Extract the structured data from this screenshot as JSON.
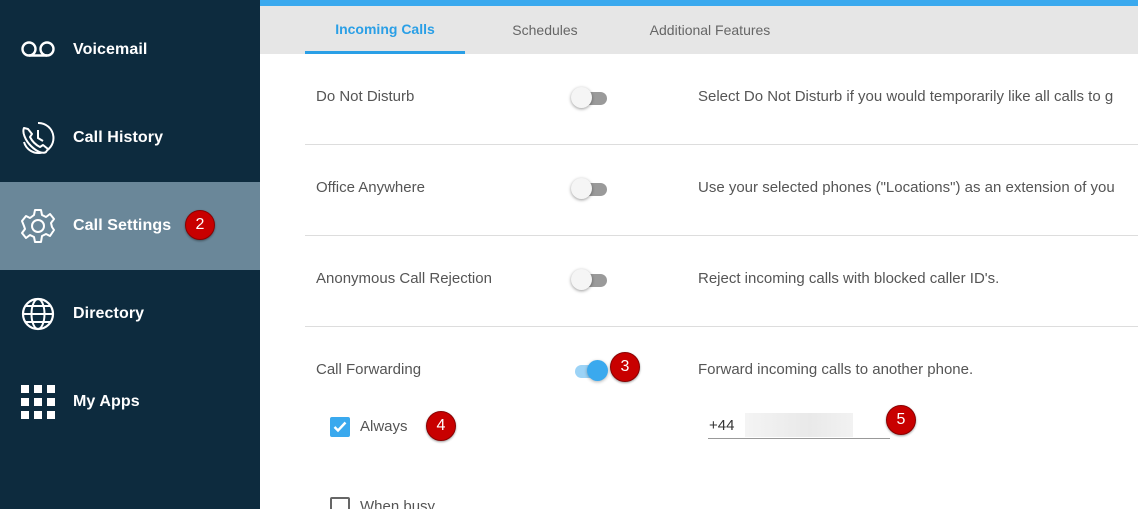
{
  "sidebar": {
    "items": [
      {
        "label": "Voicemail",
        "icon": "voicemail-icon"
      },
      {
        "label": "Call History",
        "icon": "call-history-icon"
      },
      {
        "label": "Call Settings",
        "icon": "gear-icon",
        "active": true,
        "badge": "2"
      },
      {
        "label": "Directory",
        "icon": "globe-icon"
      },
      {
        "label": "My Apps",
        "icon": "apps-grid-icon"
      }
    ]
  },
  "tabs": [
    {
      "label": "Incoming Calls",
      "active": true
    },
    {
      "label": "Schedules"
    },
    {
      "label": "Additional Features"
    }
  ],
  "settings": [
    {
      "label": "Do Not Disturb",
      "enabled": false,
      "description": "Select Do Not Disturb if you would temporarily like all calls to g"
    },
    {
      "label": "Office Anywhere",
      "enabled": false,
      "description": "Use your selected phones (\"Locations\") as an extension of you"
    },
    {
      "label": "Anonymous Call Rejection",
      "enabled": false,
      "description": "Reject incoming calls with blocked caller ID's."
    },
    {
      "label": "Call Forwarding",
      "enabled": true,
      "description": "Forward incoming calls to another phone.",
      "badge": "3"
    }
  ],
  "forwarding": {
    "always": {
      "label": "Always",
      "checked": true,
      "badge": "4"
    },
    "when_busy": {
      "label": "When busy",
      "checked": false
    },
    "phone": {
      "value": "+44",
      "badge": "5"
    }
  },
  "colors": {
    "sidebar_bg": "#0d2b3e",
    "sidebar_active": "#6a8799",
    "accent": "#3aa9ee",
    "badge": "#c80000"
  }
}
